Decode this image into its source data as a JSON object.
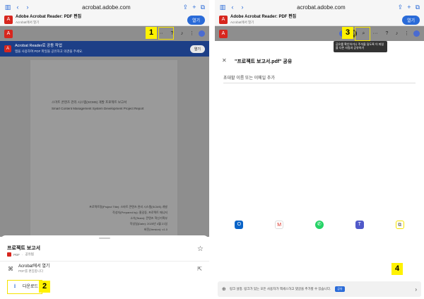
{
  "left": {
    "safari": {
      "url": "acrobat.adobe.com"
    },
    "banner": {
      "title": "Adobe Acrobat Reader: PDF 편집",
      "subtitle": "Acrobat에서 열기",
      "open": "열기"
    },
    "promo": {
      "title": "Acrobat Reader로 공동 작업",
      "desc": "앱을 사용하여 PDF 파일을 공유하고 의견을 주세요.",
      "button": "열기"
    },
    "doc": {
      "title_ko": "스마트 콘텐츠 관리 시스템(SCMS) 개발 프로젝트 보고서",
      "title_en": "Smart Content Management System Development Project Report",
      "info": [
        "프로젝트명(Project Title): 스마트 콘텐츠 관리 시스템(SCMS) 개발",
        "작성자(Prepared by): 홍길동, 프로젝트 매니저",
        "소속(Team): 콘텐츠 혁신기획부",
        "작성일(Date): 2025년 4월 21일",
        "버전(Version): v1.0"
      ]
    },
    "sheet": {
      "title": "프로젝트 보고서",
      "meta_type": "PDF",
      "meta_shared": "공유됨",
      "open_acrobat": "Acrobat에서 열기",
      "open_acrobat_sub": "PDF를 편집합니다",
      "download": "다운로드"
    },
    "callouts": {
      "one": "1",
      "two": "2"
    }
  },
  "right": {
    "safari": {
      "url": "acrobat.adobe.com"
    },
    "banner": {
      "title": "Adobe Acrobat Reader: PDF 편집",
      "subtitle": "Acrobat에서 열기",
      "open": "열기"
    },
    "tooltip": "공유를 확인하거나 주석을 달도록 이 파일을 다른 사람과 공유하기",
    "share_title": "\"프로젝트 보고서.pdf\" 공유",
    "email_placeholder": "초대할 이름 또는 이메일 추가",
    "footer": {
      "text": "링크 설정. 링크가 있는 모든 사용자가 액세스하고 댓글을 추가할 수 있습니다.",
      "badge": "공유"
    },
    "callouts": {
      "three": "3",
      "four": "4"
    }
  }
}
